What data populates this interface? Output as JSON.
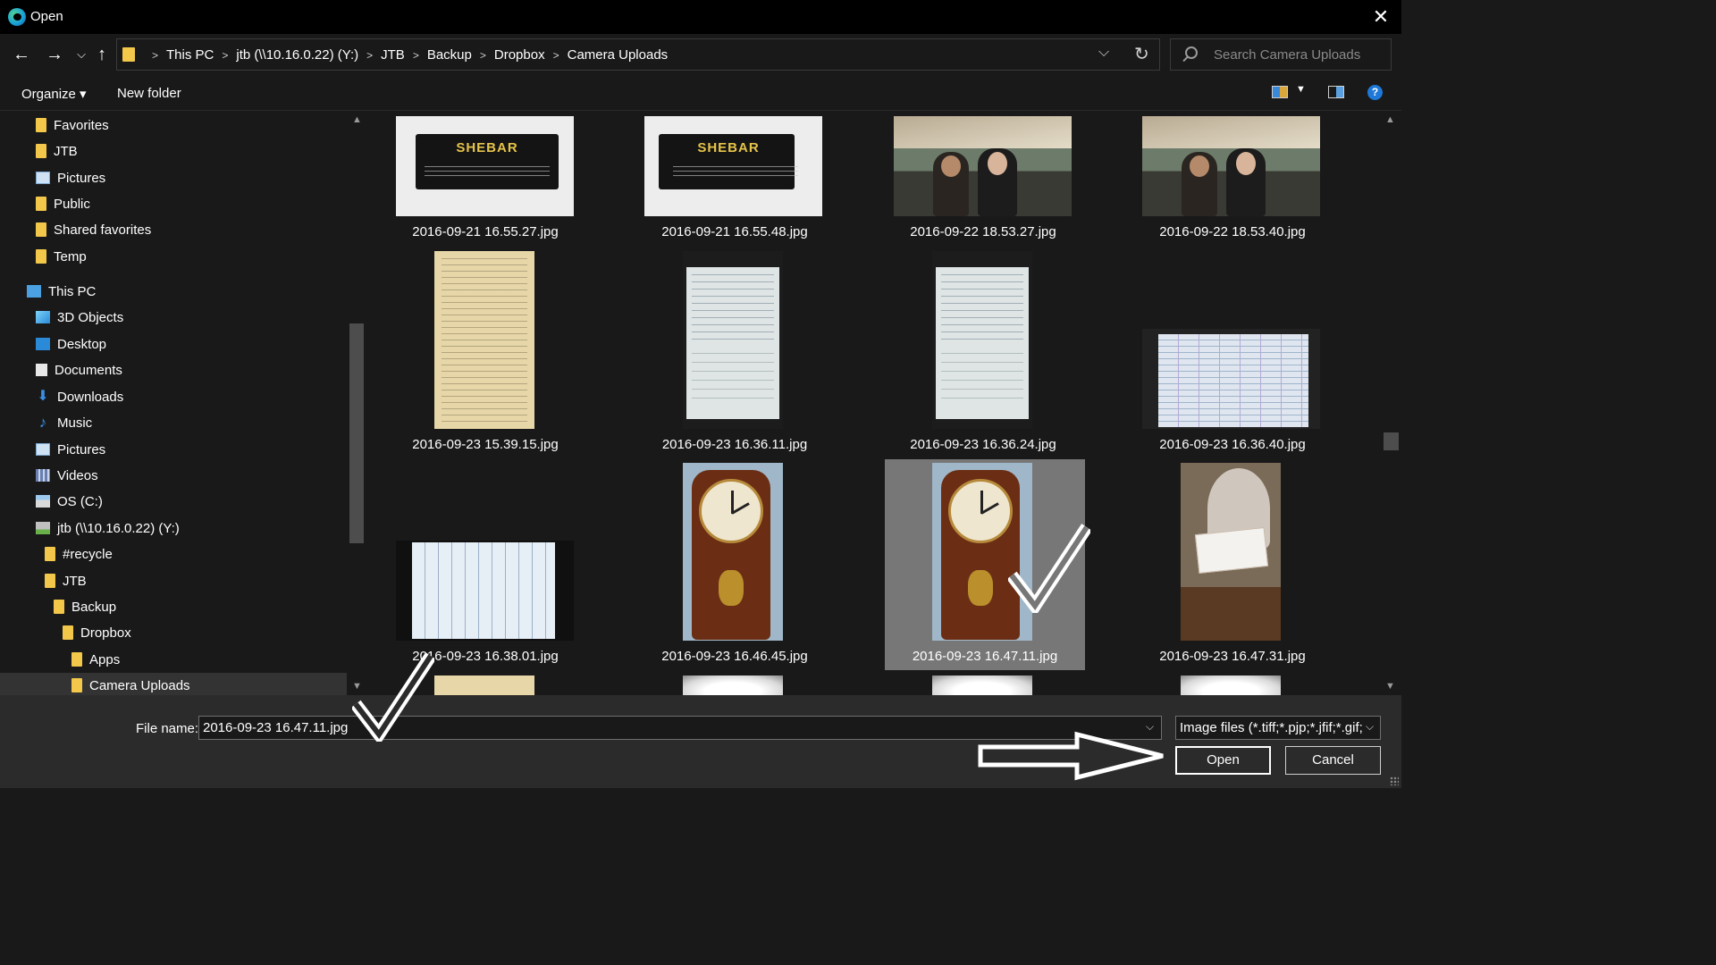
{
  "window": {
    "title": "Open"
  },
  "address": {
    "crumbs": [
      "This PC",
      "jtb (\\\\10.16.0.22) (Y:)",
      "JTB",
      "Backup",
      "Dropbox",
      "Camera Uploads"
    ]
  },
  "search": {
    "placeholder": "Search Camera Uploads"
  },
  "toolbar": {
    "organize_label": "Organize ▾",
    "new_folder_label": "New folder",
    "help_label": "?"
  },
  "navpane": {
    "items": [
      {
        "label": "Favorites",
        "icon": "folder-icon"
      },
      {
        "label": "JTB",
        "icon": "folder-icon"
      },
      {
        "label": "Pictures",
        "icon": "pictures-icon"
      },
      {
        "label": "Public",
        "icon": "folder-icon"
      },
      {
        "label": "Shared favorites",
        "icon": "folder-icon"
      },
      {
        "label": "Temp",
        "icon": "folder-icon"
      },
      {
        "label": "This PC",
        "icon": "pc-icon"
      },
      {
        "label": "3D Objects",
        "icon": "3d-objects-icon"
      },
      {
        "label": "Desktop",
        "icon": "desktop-icon"
      },
      {
        "label": "Documents",
        "icon": "documents-icon"
      },
      {
        "label": "Downloads",
        "icon": "downloads-icon"
      },
      {
        "label": "Music",
        "icon": "music-icon"
      },
      {
        "label": "Pictures",
        "icon": "pictures-icon"
      },
      {
        "label": "Videos",
        "icon": "videos-icon"
      },
      {
        "label": "OS (C:)",
        "icon": "drive-icon"
      },
      {
        "label": "jtb (\\\\10.16.0.22) (Y:)",
        "icon": "network-drive-icon"
      },
      {
        "label": "#recycle",
        "icon": "folder-icon"
      },
      {
        "label": "JTB",
        "icon": "folder-icon"
      },
      {
        "label": "Backup",
        "icon": "folder-icon"
      },
      {
        "label": "Dropbox",
        "icon": "folder-icon"
      },
      {
        "label": "Apps",
        "icon": "folder-icon"
      },
      {
        "label": "Camera Uploads",
        "icon": "folder-icon",
        "selected": true
      }
    ]
  },
  "files": [
    {
      "name": "2016-09-21 16.55.27.jpg",
      "thumb": "sign",
      "sign_text": "SHEBAR"
    },
    {
      "name": "2016-09-21 16.55.48.jpg",
      "thumb": "sign",
      "sign_text": "SHEBAR"
    },
    {
      "name": "2016-09-22 18.53.27.jpg",
      "thumb": "crowd"
    },
    {
      "name": "2016-09-22 18.53.40.jpg",
      "thumb": "crowd"
    },
    {
      "name": "2016-09-23 15.39.15.jpg",
      "thumb": "paper-yellow"
    },
    {
      "name": "2016-09-23 16.36.11.jpg",
      "thumb": "receipt"
    },
    {
      "name": "2016-09-23 16.36.24.jpg",
      "thumb": "receipt"
    },
    {
      "name": "2016-09-23 16.36.40.jpg",
      "thumb": "ledger"
    },
    {
      "name": "2016-09-23 16.38.01.jpg",
      "thumb": "notebook"
    },
    {
      "name": "2016-09-23 16.46.45.jpg",
      "thumb": "clock"
    },
    {
      "name": "2016-09-23 16.47.11.jpg",
      "thumb": "clock",
      "selected": true
    },
    {
      "name": "2016-09-23 16.47.31.jpg",
      "thumb": "tag"
    }
  ],
  "footer": {
    "file_name_label": "File name:",
    "file_name_value": "2016-09-23 16.47.11.jpg",
    "filter_value": "Image files (*.tiff;*.pjp;*.jfif;*.gif;",
    "open_label": "Open",
    "cancel_label": "Cancel"
  },
  "colors": {
    "selected_tile": "#777777",
    "background": "#191919",
    "footer": "#2b2b2b"
  }
}
